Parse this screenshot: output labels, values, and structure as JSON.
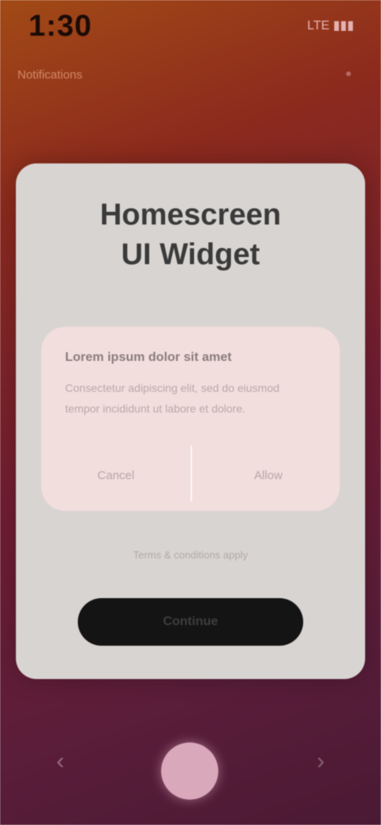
{
  "status_bar": {
    "time": "1:30",
    "indicators": "LTE ▮▮▮",
    "subline": "Notifications"
  },
  "dialog": {
    "title": "Homescreen\nUI Widget",
    "panel": {
      "heading": "Lorem ipsum dolor sit amet",
      "body": "Consectetur adipiscing elit, sed do eiusmod tempor incididunt ut labore et dolore.",
      "left_button": "Cancel",
      "right_button": "Allow"
    },
    "footnote": "Terms & conditions apply",
    "primary_button": "Continue"
  },
  "nav": {
    "left_icon": "back-icon",
    "home_icon": "home-button-icon",
    "right_icon": "recents-icon"
  },
  "colors": {
    "background_top": "#a24a16",
    "background_bottom": "#4a1a34",
    "card": "#d8d4d2",
    "panel": "#f2dedd",
    "primary_button": "#141414",
    "home_button": "#d9a8bb"
  }
}
